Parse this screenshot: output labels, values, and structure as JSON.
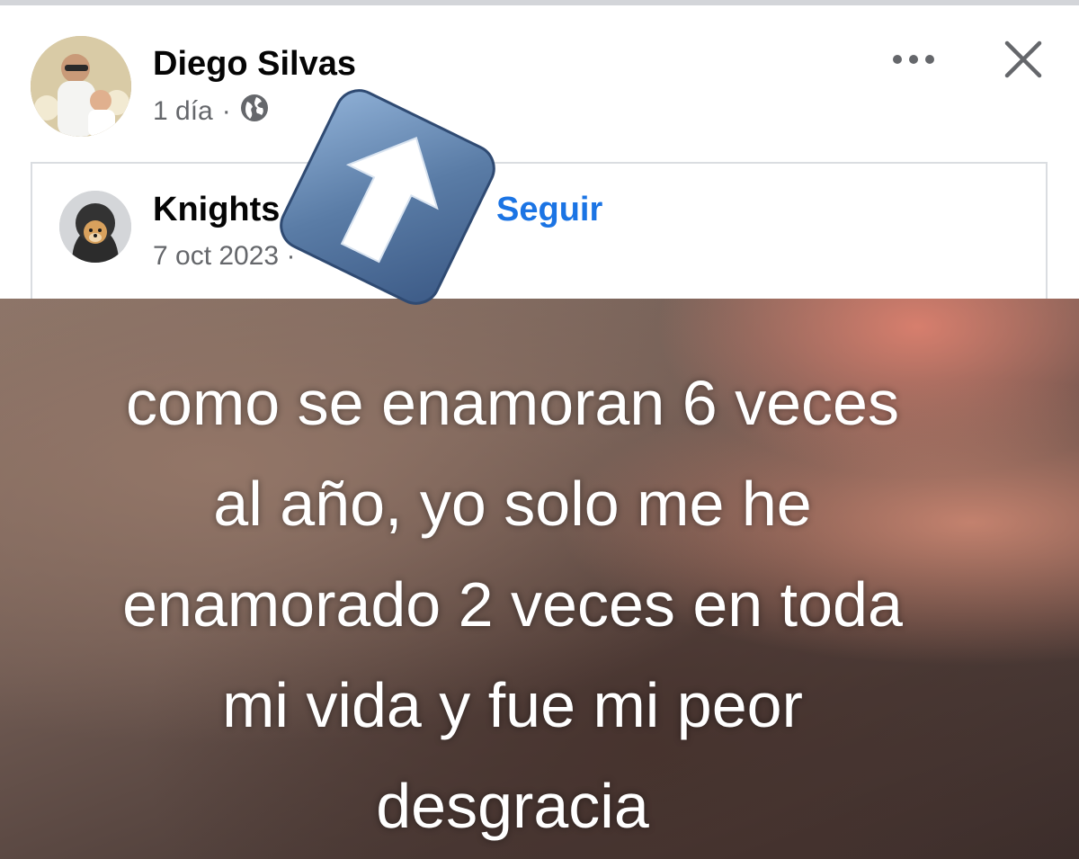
{
  "post": {
    "author": "Diego Silvas",
    "time": "1 día",
    "separator": "·",
    "audience_icon": "globe-icon"
  },
  "header_actions": {
    "more_icon": "more-options-icon",
    "close_icon": "close-icon"
  },
  "shared_post": {
    "author": "Knights",
    "follow_label": "Seguir",
    "date": "7 oct 2023",
    "separator": "·"
  },
  "image_caption": {
    "lines": [
      "como se enamoran 6 veces",
      "al año, yo solo me he",
      "enamorado 2 veces en toda",
      "mi vida y fue mi peor",
      "desgracia"
    ]
  },
  "overlay": {
    "icon": "share-arrow-icon",
    "colors": {
      "tile": "#5a7ca6",
      "arrow": "#ffffff"
    }
  },
  "colors": {
    "link": "#1b74e4",
    "secondary_text": "#65676b",
    "primary_text": "#050505"
  }
}
